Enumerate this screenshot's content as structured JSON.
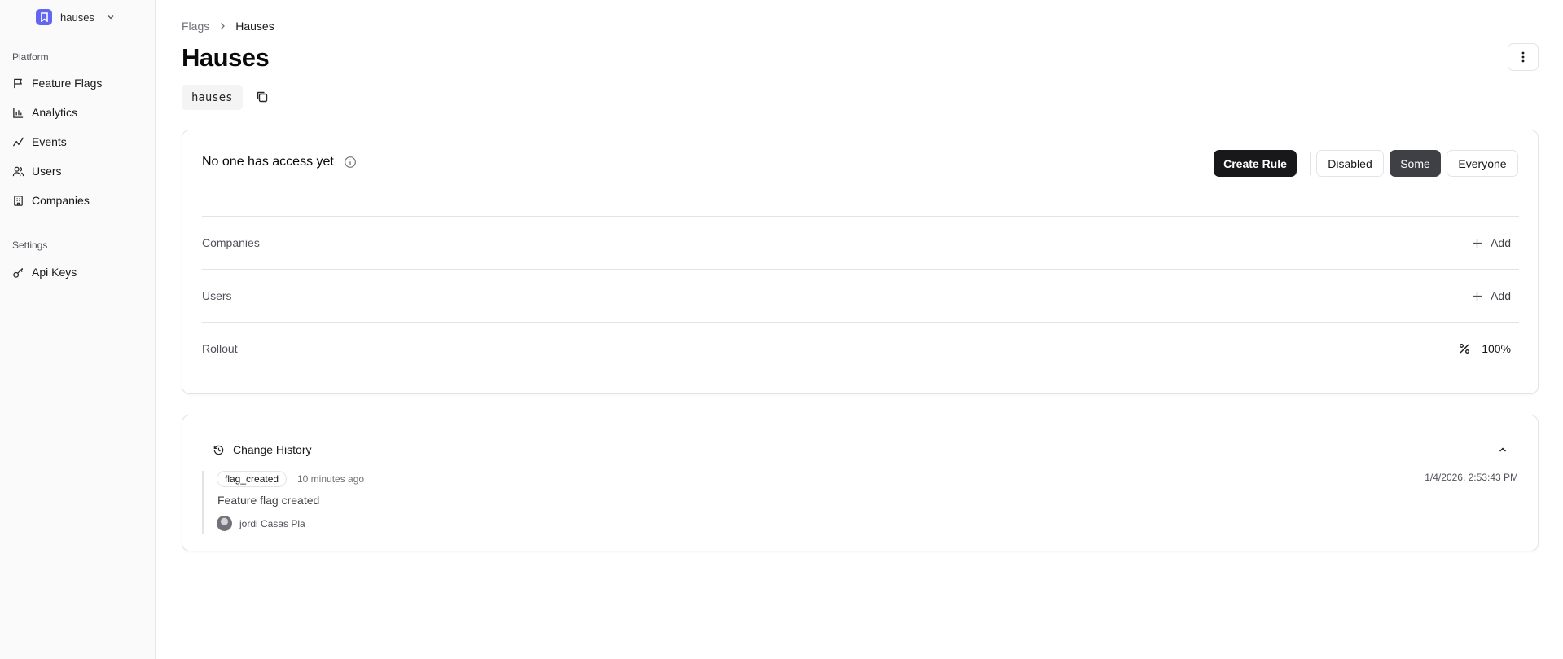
{
  "sidebar": {
    "workspace": {
      "name": "hauses",
      "logo_color": "#6366f1"
    },
    "sections": [
      {
        "label": "Platform",
        "items": [
          {
            "label": "Feature Flags",
            "icon": "flag-icon"
          },
          {
            "label": "Analytics",
            "icon": "bar-chart-icon"
          },
          {
            "label": "Events",
            "icon": "activity-icon"
          },
          {
            "label": "Users",
            "icon": "users-icon"
          },
          {
            "label": "Companies",
            "icon": "building-icon"
          }
        ]
      },
      {
        "label": "Settings",
        "items": [
          {
            "label": "Api Keys",
            "icon": "key-icon"
          }
        ]
      }
    ]
  },
  "breadcrumb": {
    "parent": "Flags",
    "current": "Hauses"
  },
  "page": {
    "title": "Hauses",
    "flag_key": "hauses"
  },
  "access": {
    "title": "No one has access yet",
    "buttons": {
      "create_rule": "Create Rule",
      "disabled": "Disabled",
      "some": "Some",
      "everyone": "Everyone"
    },
    "selected": "Some",
    "rows": [
      {
        "label": "Companies",
        "action": "Add"
      },
      {
        "label": "Users",
        "action": "Add"
      },
      {
        "label": "Rollout",
        "value": "100%"
      }
    ]
  },
  "history": {
    "title": "Change History",
    "events": [
      {
        "tag": "flag_created",
        "relative_time": "10 minutes ago",
        "timestamp": "1/4/2026, 2:53:43 PM",
        "description": "Feature flag created",
        "user": "jordi Casas Pla"
      }
    ]
  },
  "colors": {
    "primary_dark": "#18181b",
    "selected_segment": "#3f3f46",
    "border": "#e4e4e7"
  }
}
